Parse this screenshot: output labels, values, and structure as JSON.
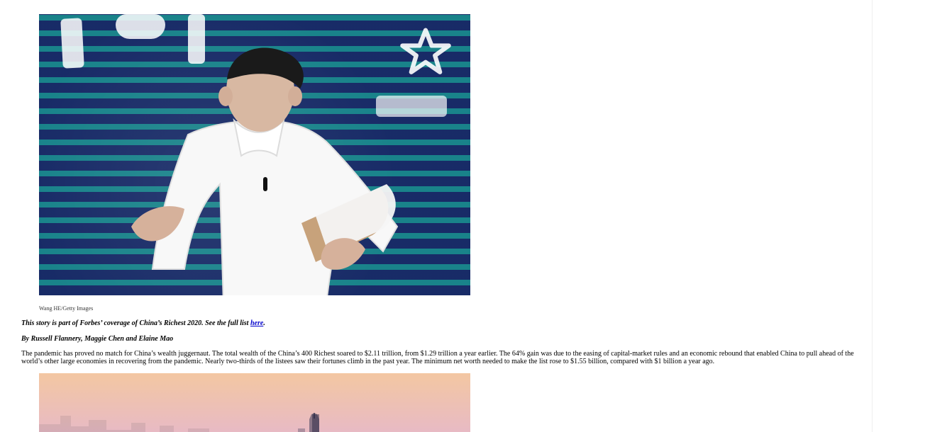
{
  "figure_top": {
    "caption": "Wang HE/Getty Images",
    "icons": {
      "person": "person-photo",
      "star": "star-icon",
      "background": "striped-led-wall"
    }
  },
  "intro": {
    "text_before_link": "This story is part of Forbes’ coverage of China’s Richest 2020. See the full list ",
    "link_text": "here",
    "text_after_link": "."
  },
  "byline": "By Russell Flannery, Maggie Chen and Elaine Mao",
  "body": {
    "paragraph_1": "The pandemic has proved no match for China’s wealth juggernaut. The total wealth of the China’s 400 Richest soared to $2.11 trillion, from $1.29 trillion a year earlier. The 64% gain was due to the easing of capital-market rules and an economic rebound that enabled China to pull ahead of the world’s other large economies in recovering from the pandemic. Nearly two-thirds of the listees saw their fortunes climb in the past year. The minimum net worth needed to make the list rose to $1.55 billion, compared with $1 billion a year ago."
  },
  "colors": {
    "link": "#0000cc",
    "top_photo_primary": "#1b2e6a",
    "top_photo_secondary": "#1f8a92",
    "bottom_photo_sky": "#f1c9a0"
  }
}
